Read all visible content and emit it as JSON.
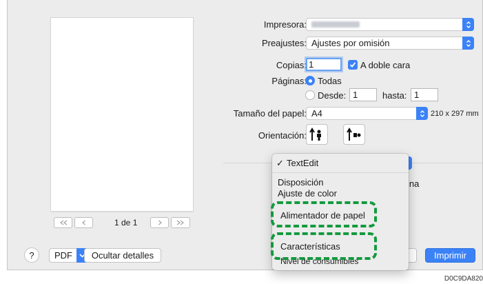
{
  "printer": {
    "label": "Impresora:",
    "value_blurred": true
  },
  "presets": {
    "label": "Preajustes:",
    "value": "Ajustes por omisión"
  },
  "copies": {
    "label": "Copias:",
    "value": "1",
    "duplex_label": "A doble cara",
    "duplex_checked": true
  },
  "pages": {
    "label": "Páginas:",
    "all_label": "Todas",
    "from_label": "Desde:",
    "from_value": "1",
    "to_label": "hasta:",
    "to_value": "1",
    "selected": "all"
  },
  "paper_size": {
    "label": "Tamaño del papel:",
    "value": "A4",
    "dimensions": "210 x 297 mm"
  },
  "orientation": {
    "label": "Orientación:",
    "options": [
      "portrait",
      "landscape"
    ],
    "selected": "portrait"
  },
  "preview": {
    "page_label": "1 de 1"
  },
  "bottom": {
    "help_label": "?",
    "pdf_label": "PDF",
    "hide_details_label": "Ocultar detalles",
    "print_label": "Imprimir"
  },
  "behind_text": "ina",
  "menu": {
    "items": [
      {
        "label": "TextEdit",
        "checked": true
      },
      {
        "label": "Disposición"
      },
      {
        "label": "Ajuste de color"
      },
      {
        "label": "Alimentador de papel",
        "highlighted": true
      },
      {
        "label": "Características",
        "highlighted": true
      },
      {
        "label": "Nivel de consumibles"
      }
    ]
  },
  "image_code": "D0C9DA820",
  "colors": {
    "accent": "#3b82f7",
    "highlight": "#139a3e",
    "dialog_bg": "#ececec"
  }
}
